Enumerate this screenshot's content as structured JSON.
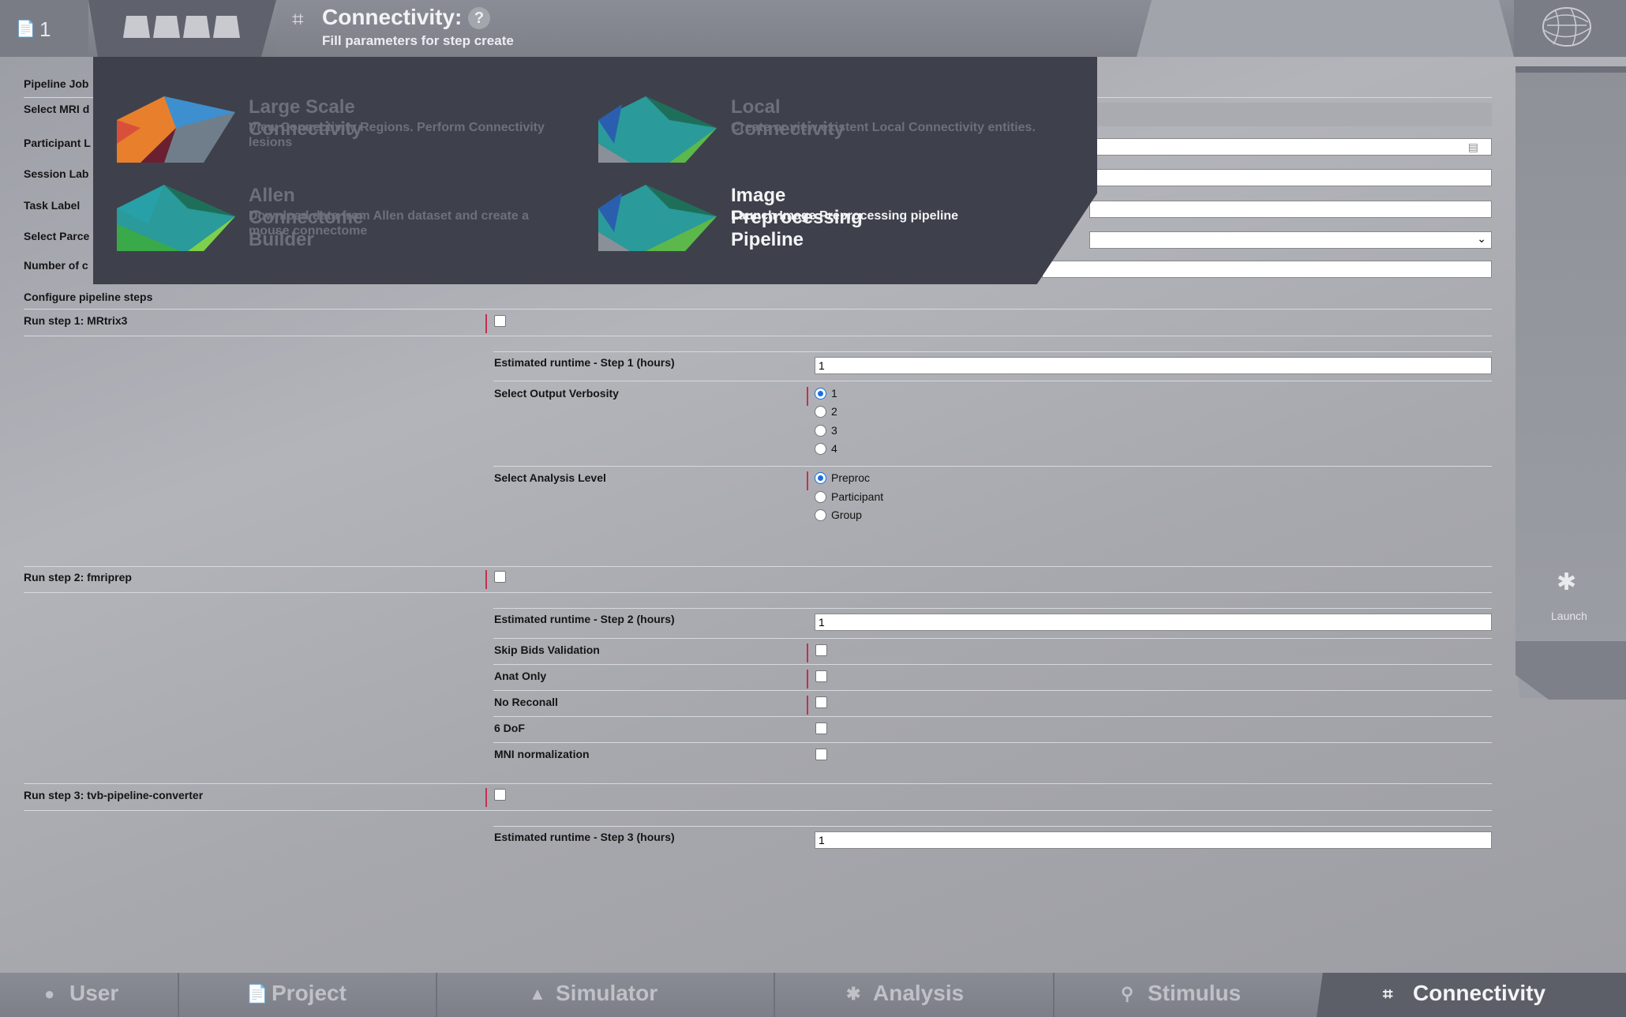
{
  "project": {
    "id": "1"
  },
  "header": {
    "title": "Connectivity:",
    "help": "?",
    "subtitle": "Fill parameters for step create"
  },
  "menu": {
    "items": [
      {
        "title": "Large Scale Connectivity",
        "desc": "View Connectivity Regions. Perform Connectivity lesions"
      },
      {
        "title": "Local Connectivity",
        "desc": "Create or view existent Local Connectivity entities."
      },
      {
        "title": "Allen Connectome Builder",
        "desc": "Download data from Allen dataset and create a mouse connectome"
      },
      {
        "title": "Image Preprocessing Pipeline",
        "desc": "Launch Image Preprocessing pipeline"
      }
    ]
  },
  "form": {
    "labels": {
      "pipeline_job": "Pipeline Job",
      "select_mri": "Select MRI d",
      "participant": "Participant L",
      "session": "Session Lab",
      "task": "Task Label",
      "parcellation": "Select Parce",
      "number": "Number of c",
      "configure": "Configure pipeline steps"
    },
    "step1": {
      "label": "Run step 1: MRtrix3",
      "runtime_label": "Estimated runtime - Step 1 (hours)",
      "runtime_value": "1",
      "verbosity_label": "Select Output Verbosity",
      "verbosity_options": [
        "1",
        "2",
        "3",
        "4"
      ],
      "analysis_label": "Select Analysis Level",
      "analysis_options": [
        "Preproc",
        "Participant",
        "Group"
      ]
    },
    "step2": {
      "label": "Run step 2: fmriprep",
      "runtime_label": "Estimated runtime - Step 2 (hours)",
      "runtime_value": "1",
      "skip_bids": "Skip Bids Validation",
      "anat_only": "Anat Only",
      "no_reconall": "No Reconall",
      "dof6": "6 DoF",
      "mni": "MNI normalization"
    },
    "step3": {
      "label": "Run step 3: tvb-pipeline-converter",
      "runtime_label": "Estimated runtime - Step 3 (hours)",
      "runtime_value": "1"
    }
  },
  "launch": {
    "label": "Launch"
  },
  "bottom_nav": {
    "user": "User",
    "project": "Project",
    "simulator": "Simulator",
    "analysis": "Analysis",
    "stimulus": "Stimulus",
    "connectivity": "Connectivity"
  }
}
